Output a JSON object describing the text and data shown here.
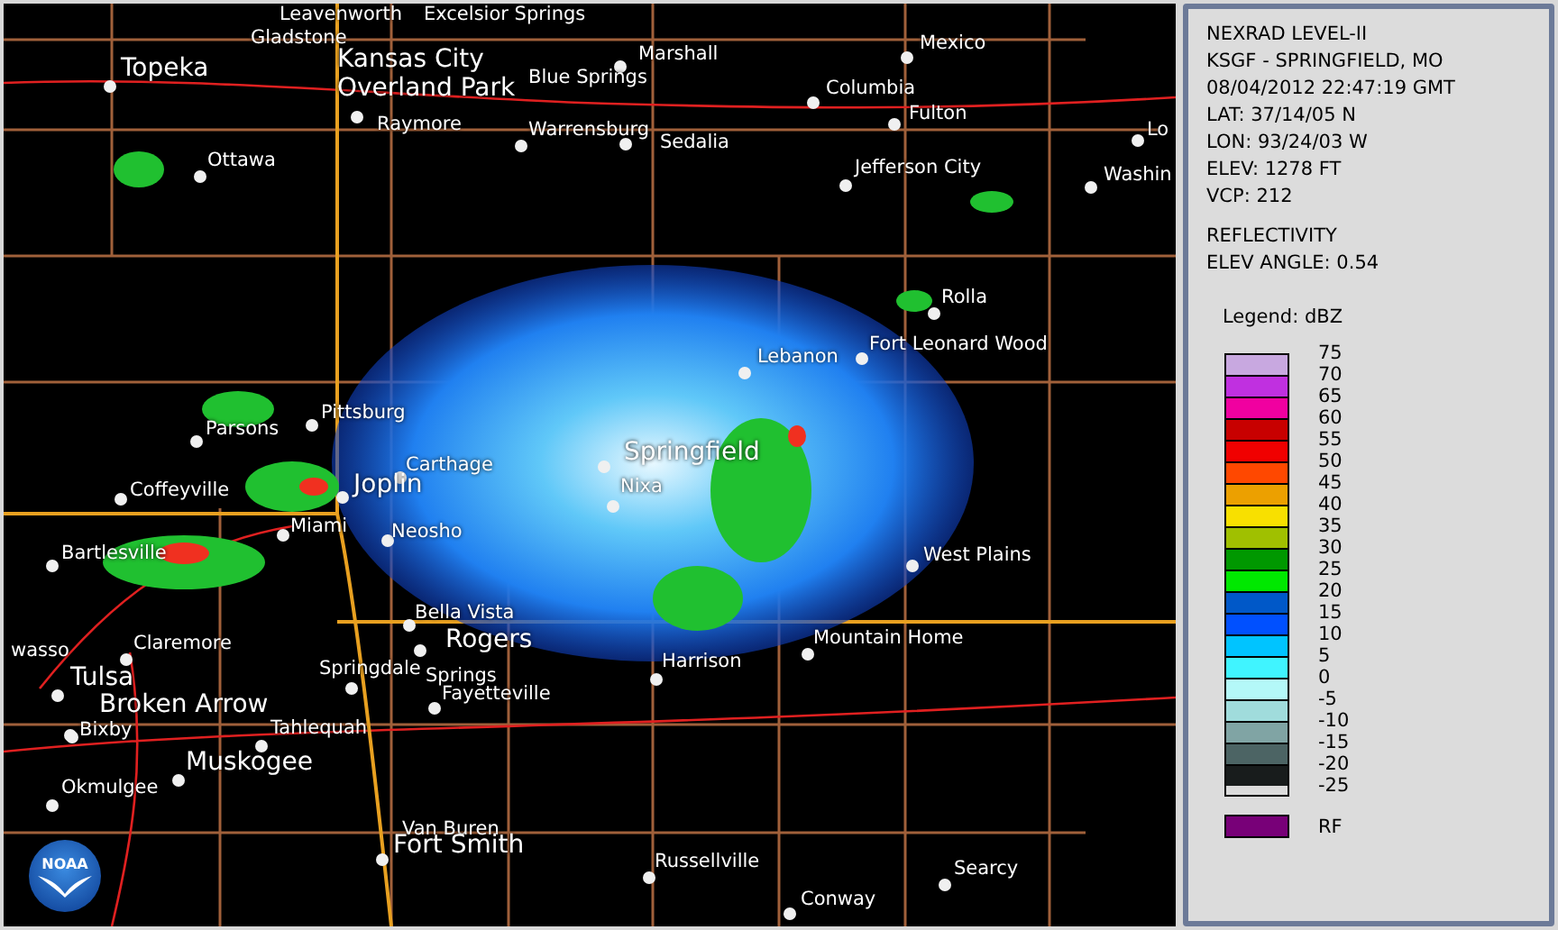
{
  "map": {
    "logo": "NOAA",
    "cities": [
      {
        "name": "Leavenworth",
        "kind": "town"
      },
      {
        "name": "Excelsior Springs",
        "kind": "town"
      },
      {
        "name": "Gladstone",
        "kind": "town"
      },
      {
        "name": "Topeka",
        "kind": "major"
      },
      {
        "name": "Kansas City",
        "kind": "major"
      },
      {
        "name": "Marshall",
        "kind": "town"
      },
      {
        "name": "Mexico",
        "kind": "town"
      },
      {
        "name": "Overland Park",
        "kind": "major"
      },
      {
        "name": "Blue Springs",
        "kind": "town"
      },
      {
        "name": "Columbia",
        "kind": "town"
      },
      {
        "name": "Raymore",
        "kind": "town"
      },
      {
        "name": "Warrensburg",
        "kind": "town"
      },
      {
        "name": "Fulton",
        "kind": "town"
      },
      {
        "name": "Sedalia",
        "kind": "town"
      },
      {
        "name": "Lo",
        "kind": "town"
      },
      {
        "name": "Ottawa",
        "kind": "town"
      },
      {
        "name": "Jefferson City",
        "kind": "town"
      },
      {
        "name": "Washin",
        "kind": "town"
      },
      {
        "name": "Rolla",
        "kind": "town"
      },
      {
        "name": "Lebanon",
        "kind": "town"
      },
      {
        "name": "Fort Leonard Wood",
        "kind": "town"
      },
      {
        "name": "Pittsburg",
        "kind": "town"
      },
      {
        "name": "Parsons",
        "kind": "town"
      },
      {
        "name": "Carthage",
        "kind": "town"
      },
      {
        "name": "Coffeyville",
        "kind": "town"
      },
      {
        "name": "Joplin",
        "kind": "major"
      },
      {
        "name": "Springfield",
        "kind": "major"
      },
      {
        "name": "Nixa",
        "kind": "town"
      },
      {
        "name": "Miami",
        "kind": "town"
      },
      {
        "name": "Bartlesville",
        "kind": "town"
      },
      {
        "name": "Neosho",
        "kind": "town"
      },
      {
        "name": "West Plains",
        "kind": "town"
      },
      {
        "name": "Bella Vista",
        "kind": "town"
      },
      {
        "name": "wasso",
        "kind": "town"
      },
      {
        "name": "Claremore",
        "kind": "town"
      },
      {
        "name": "Rogers",
        "kind": "major"
      },
      {
        "name": "Mountain Home",
        "kind": "town"
      },
      {
        "name": "Tulsa",
        "kind": "major"
      },
      {
        "name": "Springdale",
        "kind": "town"
      },
      {
        "name": "Springs",
        "kind": "town"
      },
      {
        "name": "Harrison",
        "kind": "town"
      },
      {
        "name": "Broken Arrow",
        "kind": "major"
      },
      {
        "name": "Fayetteville",
        "kind": "town"
      },
      {
        "name": "Bixby",
        "kind": "town"
      },
      {
        "name": "Tahlequah",
        "kind": "town"
      },
      {
        "name": "Muskogee",
        "kind": "major"
      },
      {
        "name": "Okmulgee",
        "kind": "town"
      },
      {
        "name": "Van Buren",
        "kind": "town"
      },
      {
        "name": "Fort Smith",
        "kind": "major"
      },
      {
        "name": "Russellville",
        "kind": "town"
      },
      {
        "name": "Searcy",
        "kind": "town"
      },
      {
        "name": "Conway",
        "kind": "town"
      }
    ]
  },
  "info": {
    "lines": [
      "NEXRAD LEVEL-II",
      "KSGF - SPRINGFIELD, MO",
      "08/04/2012 22:47:19 GMT",
      "LAT: 37/14/05 N",
      "LON: 93/24/03 W",
      "ELEV: 1278 FT",
      "VCP: 212"
    ],
    "product": [
      "REFLECTIVITY",
      "ELEV ANGLE: 0.54"
    ]
  },
  "legend": {
    "title": "Legend: dBZ",
    "scale_labels": [
      "75",
      "70",
      "65",
      "60",
      "55",
      "50",
      "45",
      "40",
      "35",
      "30",
      "25",
      "20",
      "15",
      "10",
      "5",
      "0",
      "-5",
      "-10",
      "-15",
      "-20",
      "-25"
    ],
    "bands": [
      {
        "color": "#c8a8e0"
      },
      {
        "color": "#c030e0"
      },
      {
        "color": "#f000a0"
      },
      {
        "color": "#c80000"
      },
      {
        "color": "#f00000"
      },
      {
        "color": "#ff4800"
      },
      {
        "color": "#eca000"
      },
      {
        "color": "#f8e000"
      },
      {
        "color": "#a0c000"
      },
      {
        "color": "#009800"
      },
      {
        "color": "#00e800"
      },
      {
        "color": "#0058c8"
      },
      {
        "color": "#0050ff"
      },
      {
        "color": "#00c4ff"
      },
      {
        "color": "#40f4ff"
      },
      {
        "color": "#b4f8f8"
      },
      {
        "color": "#a0dcdc"
      },
      {
        "color": "#80a4a4"
      },
      {
        "color": "#4c6464"
      },
      {
        "color": "#181c1c"
      }
    ],
    "rf": {
      "label": "RF",
      "color": "#780078"
    }
  }
}
